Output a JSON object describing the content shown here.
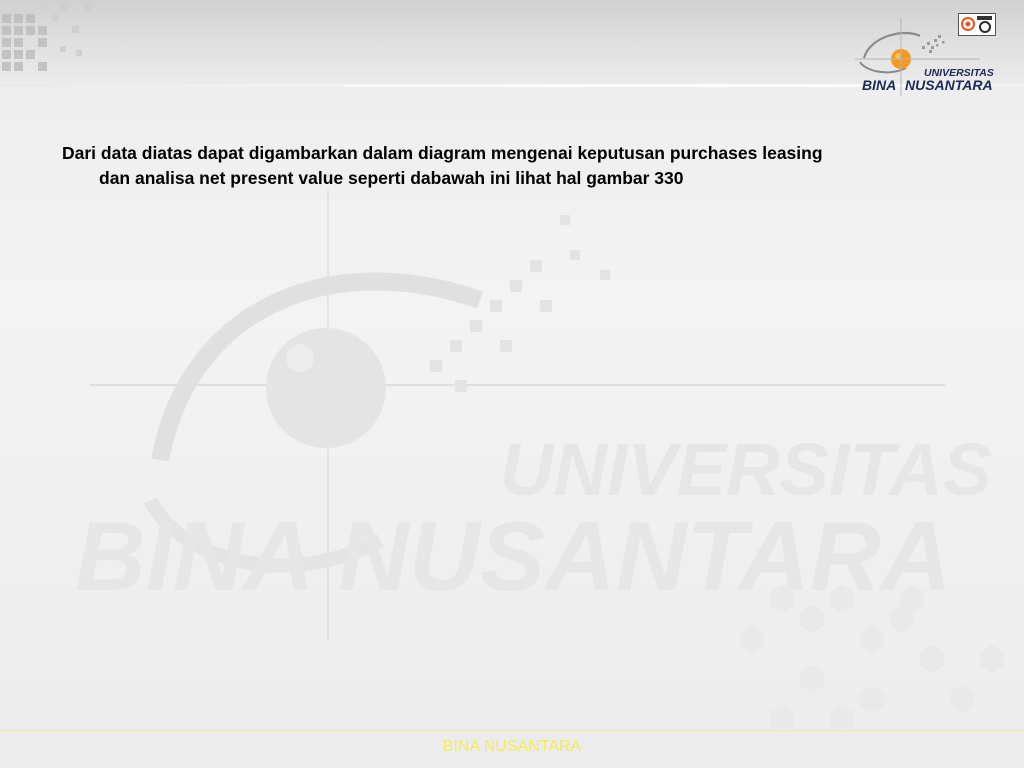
{
  "logo": {
    "line1": "UNIVERSITAS",
    "line2_left": "BINA",
    "line2_right": "NUSANTARA",
    "accent_orange": "#f39a1f",
    "navy": "#1c2a5a"
  },
  "watermark": {
    "line1": "UNIVERSITAS",
    "line2": "BINA NUSANTARA"
  },
  "content": {
    "line1": "Dari data diatas dapat digambarkan dalam diagram mengenai keputusan purchases leasing",
    "line2": "dan analisa net present value seperti dabawah ini lihat hal gambar 330"
  },
  "footer": {
    "label": "BINA NUSANTARA",
    "color": "#f5ea52"
  },
  "icons": {
    "top_right_badge": "certification-badge-icon"
  }
}
